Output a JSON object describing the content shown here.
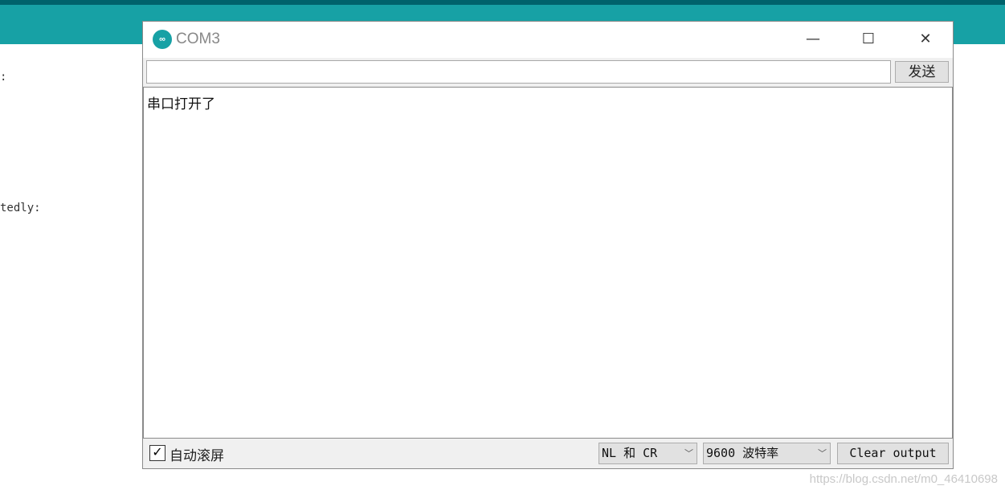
{
  "background": {
    "text1": ":",
    "text2": "tedly:"
  },
  "window": {
    "title": "COM3",
    "logo": "arduino-logo",
    "minimize": "—",
    "maximize": "☐",
    "close": "✕"
  },
  "send": {
    "input_value": "",
    "label": "发送"
  },
  "output": {
    "lines": [
      "串口打开了"
    ]
  },
  "footer": {
    "autoscroll_label": "自动滚屏",
    "autoscroll_checked": true,
    "line_ending": "NL 和 CR",
    "baud": "9600 波特率",
    "clear_label": "Clear output"
  },
  "watermark": "https://blog.csdn.net/m0_46410698",
  "colors": {
    "accent": "#17a1a5",
    "dark": "#00626b"
  }
}
